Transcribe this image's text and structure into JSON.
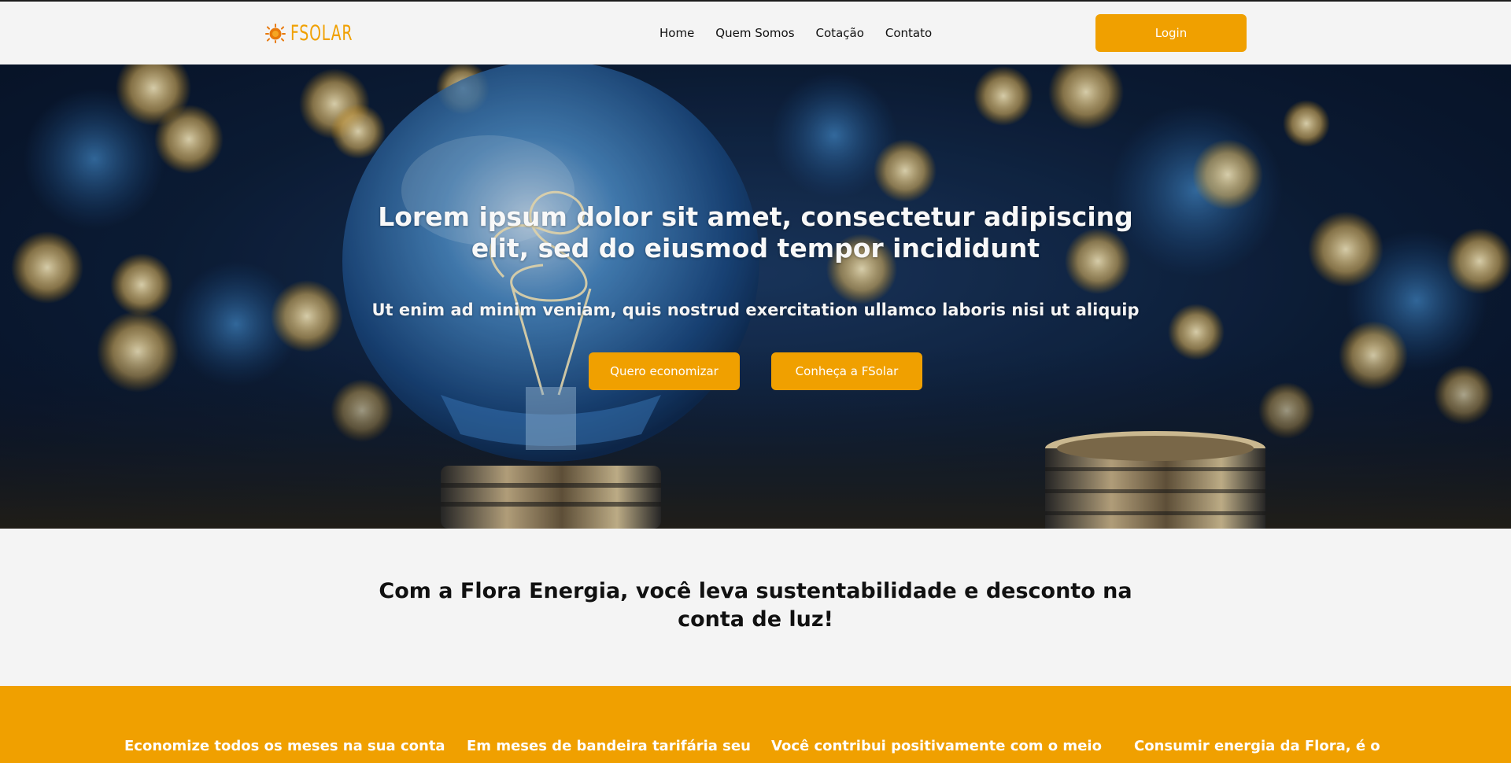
{
  "brand": {
    "name": "FSOLAR",
    "color": "#f0a000",
    "logo_icon": "sun-icon"
  },
  "nav": {
    "items": [
      {
        "label": "Home"
      },
      {
        "label": "Quem Somos"
      },
      {
        "label": "Cotação"
      },
      {
        "label": "Contato"
      }
    ],
    "login_label": "Login"
  },
  "hero": {
    "title": "Lorem ipsum dolor sit amet, consectetur adipiscing elit, sed do eiusmod tempor incididunt",
    "subtitle": "Ut enim ad minim veniam, quis nostrud exercitation ullamco laboris nisi ut aliquip",
    "primary_cta": "Quero economizar",
    "secondary_cta": "Conheça a FSolar",
    "background_image": "light bulb with bokeh lights"
  },
  "intro": {
    "heading": "Com a Flora Energia, você leva sustentabilidade e desconto na conta de luz!"
  },
  "benefits": {
    "background": "#f0a000",
    "items": [
      {
        "text": "Economize todos os meses na sua conta"
      },
      {
        "text": "Em meses de bandeira tarifária seu"
      },
      {
        "text": "Você contribui positivamente com o meio"
      },
      {
        "text": "Consumir energia da Flora, é o"
      }
    ]
  }
}
